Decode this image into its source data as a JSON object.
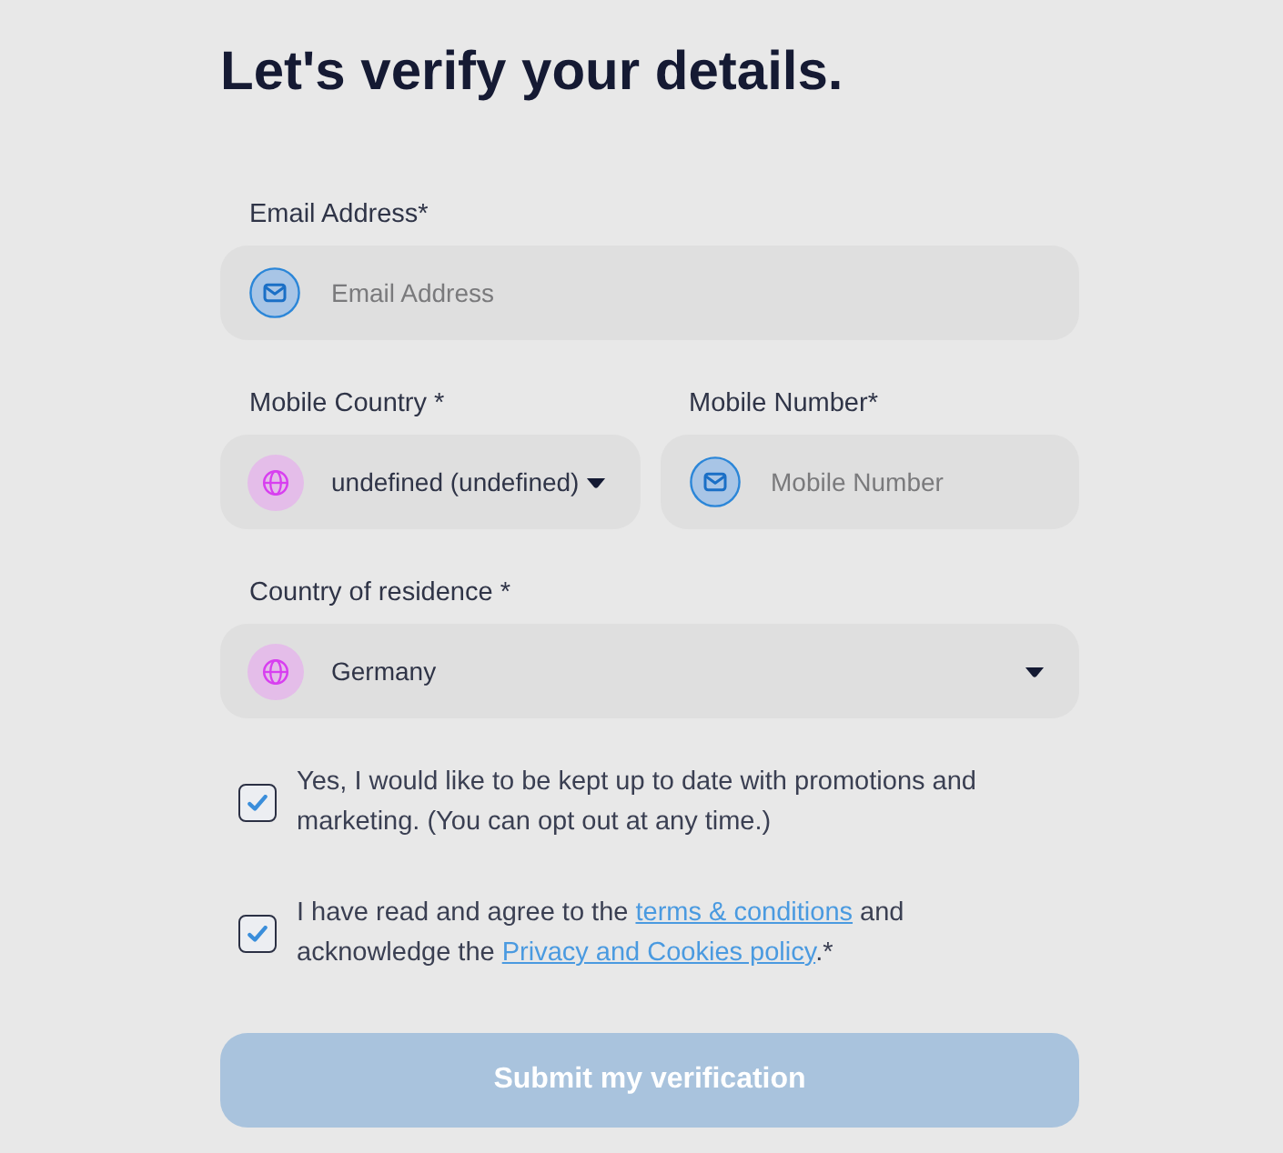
{
  "heading": "Let's verify your details.",
  "rows": [
    {
      "fields": [
        {
          "kind": "input",
          "label": "Email Address*",
          "placeholder": "Email Address"
        }
      ]
    },
    {
      "fields": [
        {
          "kind": "select",
          "label": "Mobile Country *",
          "value": "undefined (undefined)"
        },
        {
          "kind": "input",
          "label": "Mobile Number*",
          "placeholder": "Mobile Number"
        }
      ]
    },
    {
      "fields": [
        {
          "kind": "select",
          "label": "Country of residence *",
          "value": "Germany"
        }
      ]
    }
  ],
  "consents": [
    {
      "checked": true,
      "parts": [
        {
          "kind": "text",
          "text": "Yes, I would like to be kept up to date with promotions and marketing. (You can opt out at any time.)"
        }
      ]
    },
    {
      "checked": true,
      "parts": [
        {
          "kind": "text",
          "text": "I have read and agree to the "
        },
        {
          "kind": "link",
          "text": "terms & conditions"
        },
        {
          "kind": "text",
          "text": " and acknowledge the "
        },
        {
          "kind": "link",
          "text": "Privacy and Cookies policy"
        },
        {
          "kind": "text",
          "text": ".*"
        }
      ]
    }
  ],
  "submit": {
    "label": "Submit my verification",
    "disabled": true
  }
}
